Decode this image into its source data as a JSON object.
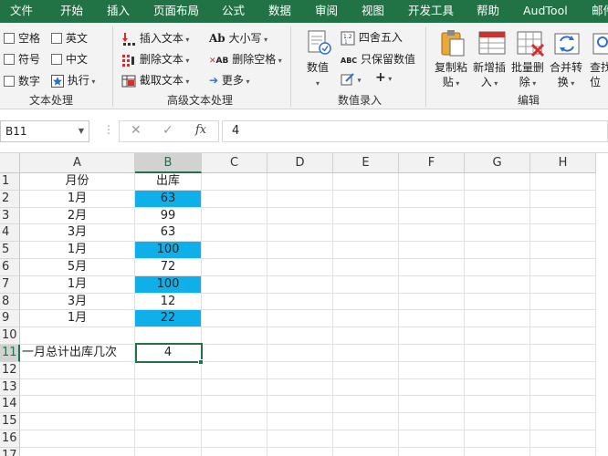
{
  "menu_tabs": [
    "文件",
    "开始",
    "插入",
    "页面布局",
    "公式",
    "数据",
    "审阅",
    "视图",
    "开发工具",
    "帮助",
    "AudTool",
    "邮件"
  ],
  "ribbon": {
    "text_processing": {
      "checkboxes": [
        "空格",
        "英文",
        "符号",
        "中文",
        "数字"
      ],
      "execute": "执行",
      "group_label": "文本处理"
    },
    "advanced_text": {
      "insert_text": "插入文本",
      "delete_text": "删除文本",
      "extract_text": "截取文本",
      "case": "大小写",
      "delete_spaces": "删除空格",
      "more": "更多",
      "case_icon": "Ab",
      "delete_spaces_icon": "AB",
      "group_label": "高级文本处理"
    },
    "number_entry": {
      "numeric": "数值",
      "round": "四舍五入",
      "keep_numeric": "只保留数值",
      "keep_numeric_icon": "ABC",
      "group_label": "数值录入"
    },
    "edit": {
      "copy_paste": [
        "复制粘",
        "贴"
      ],
      "add_insert": [
        "新增插",
        "入"
      ],
      "batch_delete": [
        "批量删",
        "除"
      ],
      "merge_convert": [
        "合并转",
        "换"
      ],
      "find_locate": [
        "查找",
        "位"
      ],
      "group_label": "编辑"
    }
  },
  "formula_bar": {
    "name_box": "B11",
    "fx": "fx",
    "value": "4"
  },
  "sheet": {
    "columns": [
      "A",
      "B",
      "C",
      "D",
      "E",
      "F",
      "G",
      "H"
    ],
    "rows": [
      "1",
      "2",
      "3",
      "4",
      "5",
      "6",
      "7",
      "8",
      "9",
      "10",
      "11",
      "12",
      "13",
      "14",
      "15",
      "16",
      "17"
    ],
    "col_a": [
      "月份",
      "1月",
      "2月",
      "3月",
      "1月",
      "5月",
      "1月",
      "3月",
      "1月",
      "",
      "一月总计出库几次"
    ],
    "col_b": [
      "出库",
      "63",
      "99",
      "63",
      "100",
      "72",
      "100",
      "12",
      "22",
      "",
      "4"
    ],
    "highlight_rows": [
      2,
      5,
      7,
      9
    ],
    "highlight_color": "#0fb0ea",
    "selected_cell": "B11",
    "accent": "#217346"
  }
}
